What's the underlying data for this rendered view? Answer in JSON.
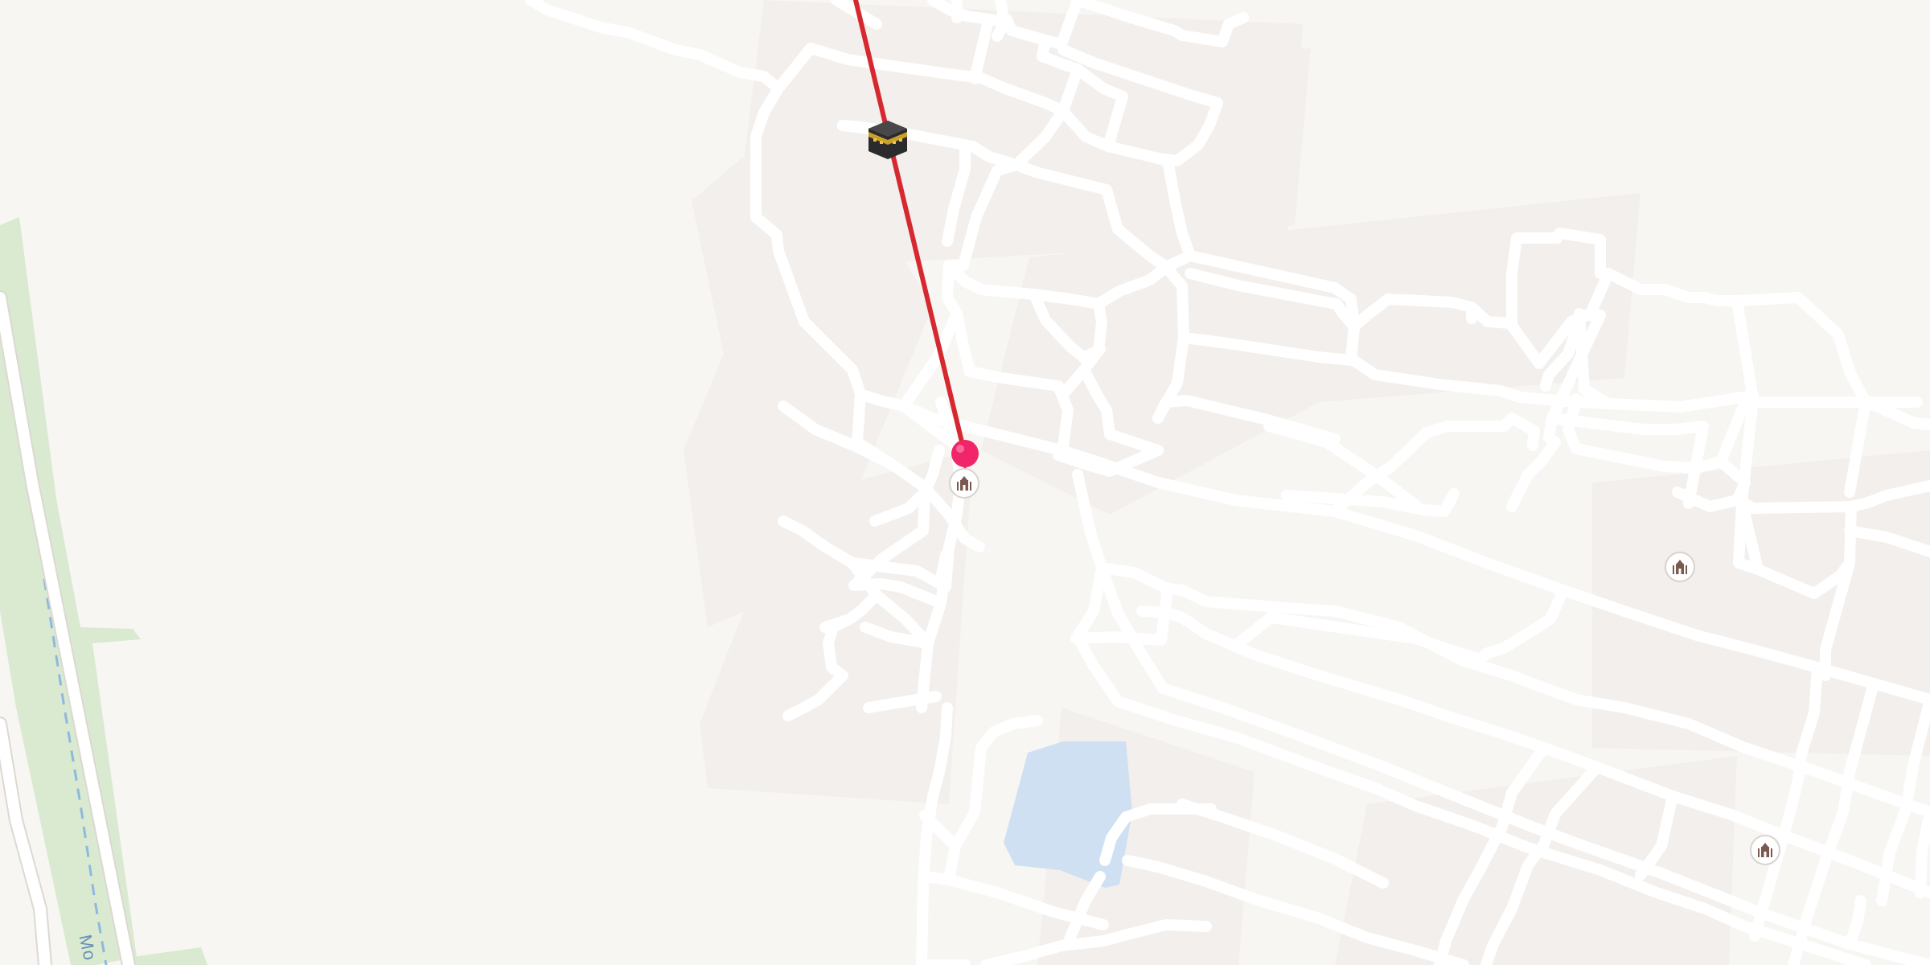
{
  "map": {
    "theme": {
      "land_color": "#f8f6f3",
      "block_color": "#f2efec",
      "road_color": "#ffffff",
      "park_color": "#d9ead0",
      "water_color": "#cfe0f3",
      "route_color": "#d6282f",
      "pin_color": "#f0256a",
      "waterway_color": "#8fb8e0"
    },
    "road_label": "Mo",
    "markers": {
      "qibla_marker": {
        "icon": "kaaba-icon"
      },
      "location_pin": {
        "icon": "map-pin-icon"
      },
      "mosques": [
        {
          "icon": "mosque-icon"
        },
        {
          "icon": "mosque-icon"
        },
        {
          "icon": "mosque-icon"
        }
      ]
    },
    "route": {
      "type": "qibla-direction-line"
    }
  }
}
